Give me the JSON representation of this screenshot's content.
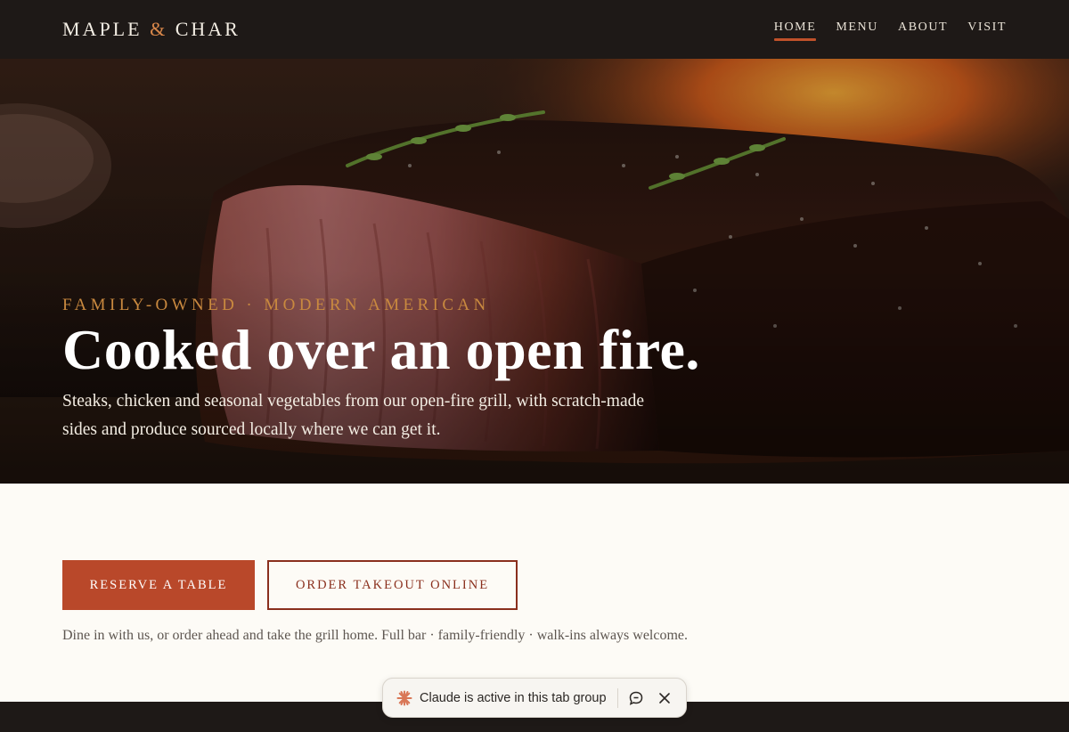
{
  "nav": {
    "brand_left": "MAPLE",
    "brand_amp": "&",
    "brand_right": "CHAR",
    "links": [
      {
        "label": "HOME",
        "active": true
      },
      {
        "label": "MENU",
        "active": false
      },
      {
        "label": "ABOUT",
        "active": false
      },
      {
        "label": "VISIT",
        "active": false
      }
    ]
  },
  "hero": {
    "eyebrow": "FAMILY-OWNED · MODERN AMERICAN",
    "headline": "Cooked over an open fire.",
    "subtext": "Steaks, chicken and seasonal vegetables from our open-fire grill, with scratch-made sides and produce sourced locally where we can get it.",
    "image_icon": "grilled-steak-photo"
  },
  "cta": {
    "primary_label": "RESERVE A TABLE",
    "secondary_label": "ORDER TAKEOUT ONLINE",
    "note": "Dine in with us, or order ahead and take the grill home. Full bar · family-friendly · walk-ins always welcome."
  },
  "claude_bar": {
    "label": "Claude is active in this tab group",
    "icons": [
      "claude-star-icon",
      "chat-icon",
      "close-icon"
    ]
  },
  "colors": {
    "nav_bg": "#1e1917",
    "accent_orange": "#c9893f",
    "primary_button": "#b9482a",
    "outline_button": "#8a2f1d",
    "page_bg": "#fdfbf6"
  }
}
